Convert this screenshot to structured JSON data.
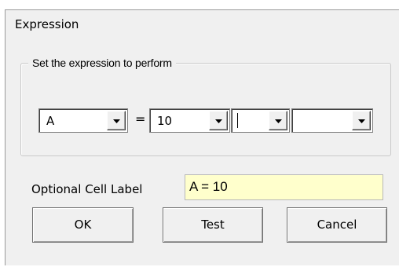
{
  "window": {
    "title": "Expression"
  },
  "expression_group": {
    "caption": "Set the expression to perform",
    "operand_left": {
      "value": "A"
    },
    "operator_symbol": "=",
    "operand_right": {
      "value": "10"
    },
    "operator2": {
      "value": ""
    },
    "operand3": {
      "value": ""
    }
  },
  "cell_label": {
    "label": "Optional Cell Label",
    "value": "A = 10"
  },
  "buttons": {
    "ok": "OK",
    "test": "Test",
    "cancel": "Cancel"
  },
  "icons": {
    "dropdown": "chevron-down-icon"
  },
  "colors": {
    "dialog_bg": "#f0f0f0",
    "input_highlight": "#ffffcc"
  }
}
